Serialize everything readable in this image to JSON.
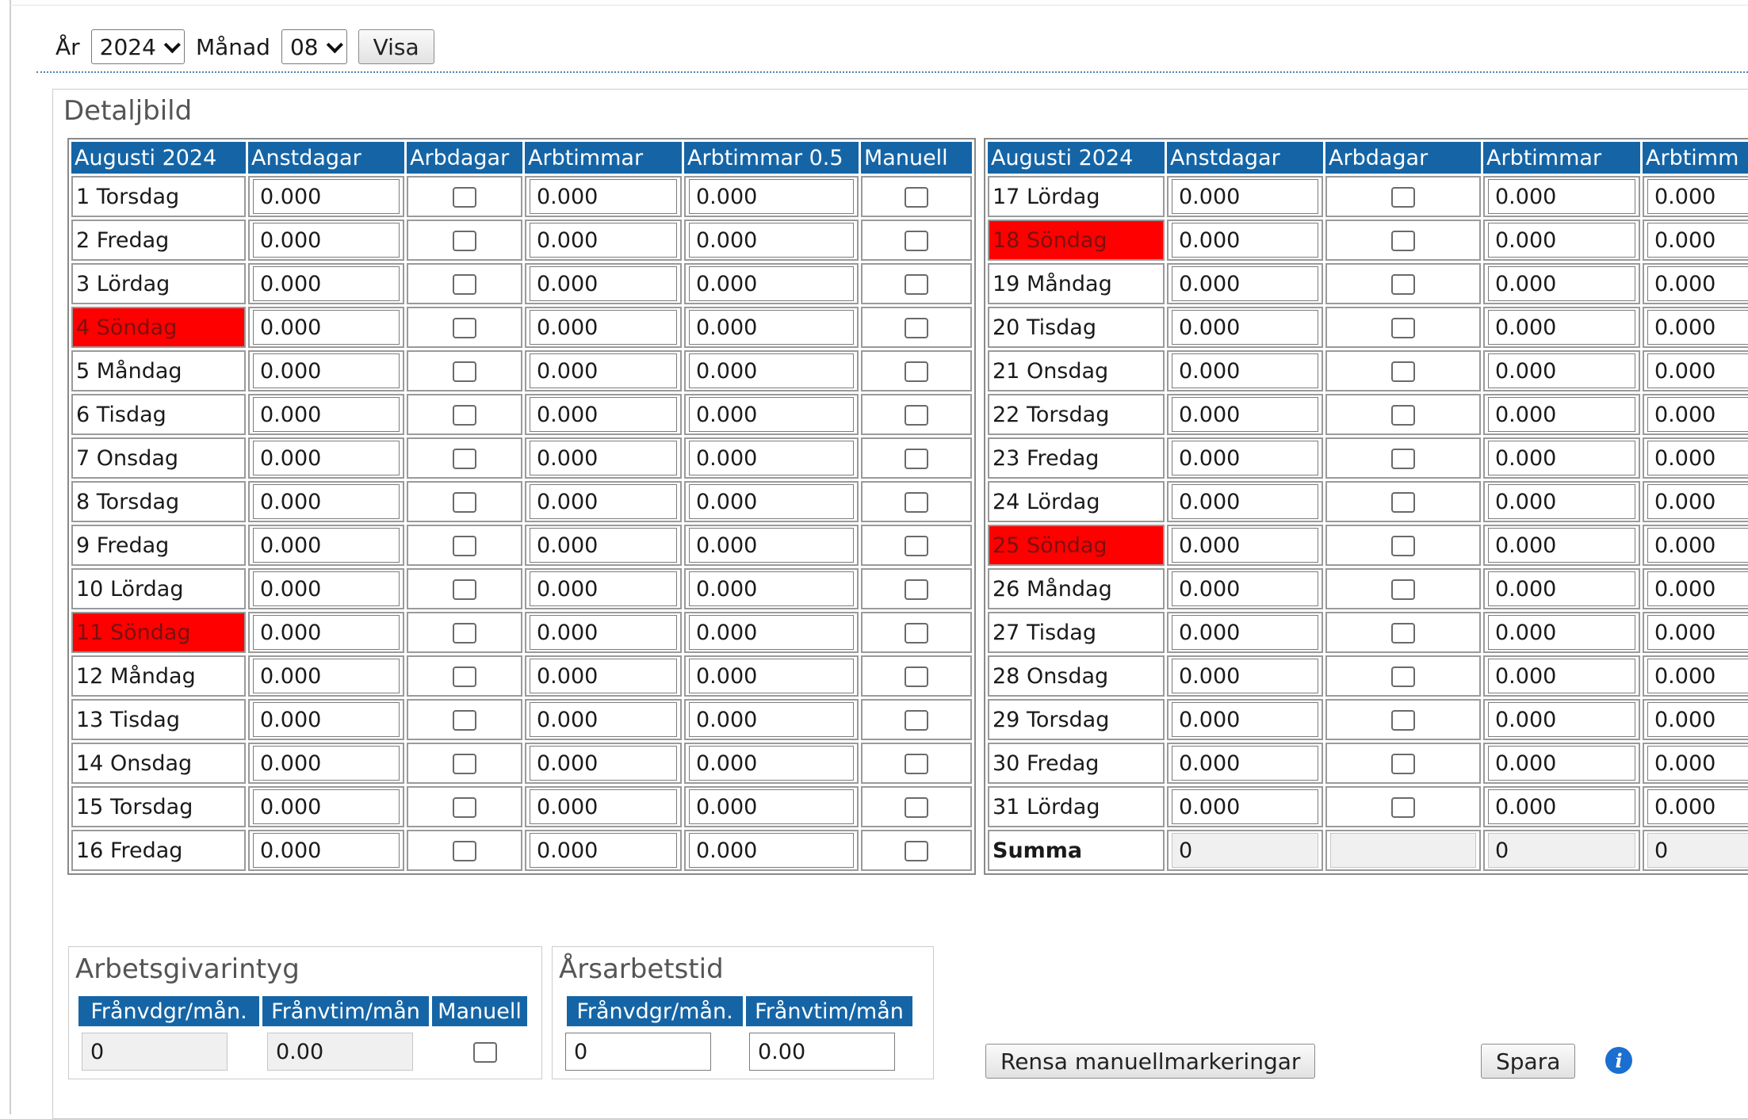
{
  "filter": {
    "year_label": "År",
    "year_value": "2024",
    "month_label": "Månad",
    "month_value": "08",
    "show_button": "Visa"
  },
  "detail": {
    "title": "Detaljbild",
    "sunday_color": "#ff0000",
    "header_color": "#1565a6",
    "left_table": {
      "headers": [
        "Augusti 2024",
        "Anstdagar",
        "Arbdagar",
        "Arbtimmar",
        "Arbtimmar 0.5",
        "Manuell"
      ],
      "rows": [
        {
          "day": "1 Torsdag",
          "anstdagar": "0.000",
          "arbtimmar": "0.000",
          "arbtimmar05": "0.000",
          "sunday": false
        },
        {
          "day": "2 Fredag",
          "anstdagar": "0.000",
          "arbtimmar": "0.000",
          "arbtimmar05": "0.000",
          "sunday": false
        },
        {
          "day": "3 Lördag",
          "anstdagar": "0.000",
          "arbtimmar": "0.000",
          "arbtimmar05": "0.000",
          "sunday": false
        },
        {
          "day": "4 Söndag",
          "anstdagar": "0.000",
          "arbtimmar": "0.000",
          "arbtimmar05": "0.000",
          "sunday": true
        },
        {
          "day": "5 Måndag",
          "anstdagar": "0.000",
          "arbtimmar": "0.000",
          "arbtimmar05": "0.000",
          "sunday": false
        },
        {
          "day": "6 Tisdag",
          "anstdagar": "0.000",
          "arbtimmar": "0.000",
          "arbtimmar05": "0.000",
          "sunday": false
        },
        {
          "day": "7 Onsdag",
          "anstdagar": "0.000",
          "arbtimmar": "0.000",
          "arbtimmar05": "0.000",
          "sunday": false
        },
        {
          "day": "8 Torsdag",
          "anstdagar": "0.000",
          "arbtimmar": "0.000",
          "arbtimmar05": "0.000",
          "sunday": false
        },
        {
          "day": "9 Fredag",
          "anstdagar": "0.000",
          "arbtimmar": "0.000",
          "arbtimmar05": "0.000",
          "sunday": false
        },
        {
          "day": "10 Lördag",
          "anstdagar": "0.000",
          "arbtimmar": "0.000",
          "arbtimmar05": "0.000",
          "sunday": false
        },
        {
          "day": "11 Söndag",
          "anstdagar": "0.000",
          "arbtimmar": "0.000",
          "arbtimmar05": "0.000",
          "sunday": true
        },
        {
          "day": "12 Måndag",
          "anstdagar": "0.000",
          "arbtimmar": "0.000",
          "arbtimmar05": "0.000",
          "sunday": false
        },
        {
          "day": "13 Tisdag",
          "anstdagar": "0.000",
          "arbtimmar": "0.000",
          "arbtimmar05": "0.000",
          "sunday": false
        },
        {
          "day": "14 Onsdag",
          "anstdagar": "0.000",
          "arbtimmar": "0.000",
          "arbtimmar05": "0.000",
          "sunday": false
        },
        {
          "day": "15 Torsdag",
          "anstdagar": "0.000",
          "arbtimmar": "0.000",
          "arbtimmar05": "0.000",
          "sunday": false
        },
        {
          "day": "16 Fredag",
          "anstdagar": "0.000",
          "arbtimmar": "0.000",
          "arbtimmar05": "0.000",
          "sunday": false
        }
      ]
    },
    "right_table": {
      "headers": [
        "Augusti 2024",
        "Anstdagar",
        "Arbdagar",
        "Arbtimmar",
        "Arbtimm"
      ],
      "rows": [
        {
          "day": "17 Lördag",
          "anstdagar": "0.000",
          "arbtimmar": "0.000",
          "arbtimmar05": "0.000",
          "sunday": false
        },
        {
          "day": "18 Söndag",
          "anstdagar": "0.000",
          "arbtimmar": "0.000",
          "arbtimmar05": "0.000",
          "sunday": true
        },
        {
          "day": "19 Måndag",
          "anstdagar": "0.000",
          "arbtimmar": "0.000",
          "arbtimmar05": "0.000",
          "sunday": false
        },
        {
          "day": "20 Tisdag",
          "anstdagar": "0.000",
          "arbtimmar": "0.000",
          "arbtimmar05": "0.000",
          "sunday": false
        },
        {
          "day": "21 Onsdag",
          "anstdagar": "0.000",
          "arbtimmar": "0.000",
          "arbtimmar05": "0.000",
          "sunday": false
        },
        {
          "day": "22 Torsdag",
          "anstdagar": "0.000",
          "arbtimmar": "0.000",
          "arbtimmar05": "0.000",
          "sunday": false
        },
        {
          "day": "23 Fredag",
          "anstdagar": "0.000",
          "arbtimmar": "0.000",
          "arbtimmar05": "0.000",
          "sunday": false
        },
        {
          "day": "24 Lördag",
          "anstdagar": "0.000",
          "arbtimmar": "0.000",
          "arbtimmar05": "0.000",
          "sunday": false
        },
        {
          "day": "25 Söndag",
          "anstdagar": "0.000",
          "arbtimmar": "0.000",
          "arbtimmar05": "0.000",
          "sunday": true
        },
        {
          "day": "26 Måndag",
          "anstdagar": "0.000",
          "arbtimmar": "0.000",
          "arbtimmar05": "0.000",
          "sunday": false
        },
        {
          "day": "27 Tisdag",
          "anstdagar": "0.000",
          "arbtimmar": "0.000",
          "arbtimmar05": "0.000",
          "sunday": false
        },
        {
          "day": "28 Onsdag",
          "anstdagar": "0.000",
          "arbtimmar": "0.000",
          "arbtimmar05": "0.000",
          "sunday": false
        },
        {
          "day": "29 Torsdag",
          "anstdagar": "0.000",
          "arbtimmar": "0.000",
          "arbtimmar05": "0.000",
          "sunday": false
        },
        {
          "day": "30 Fredag",
          "anstdagar": "0.000",
          "arbtimmar": "0.000",
          "arbtimmar05": "0.000",
          "sunday": false
        },
        {
          "day": "31 Lördag",
          "anstdagar": "0.000",
          "arbtimmar": "0.000",
          "arbtimmar05": "0.000",
          "sunday": false
        }
      ],
      "summary": {
        "label": "Summa",
        "anstdagar": "0",
        "arbdagar": "",
        "arbtimmar": "0",
        "arbtimmar05": "0"
      }
    }
  },
  "arbetsgivarintyg": {
    "title": "Arbetsgivarintyg",
    "headers": [
      "Frånvdgr/mån.",
      "Frånvtim/mån",
      "Manuell"
    ],
    "franvdgr": "0",
    "franvtim": "0.00"
  },
  "arsarbetstid": {
    "title": "Årsarbetstid",
    "headers": [
      "Frånvdgr/mån.",
      "Frånvtim/mån"
    ],
    "franvdgr": "0",
    "franvtim": "0.00"
  },
  "actions": {
    "clear_manual": "Rensa manuellmarkeringar",
    "save": "Spara",
    "info_glyph": "i",
    "info_icon": "info-icon"
  }
}
